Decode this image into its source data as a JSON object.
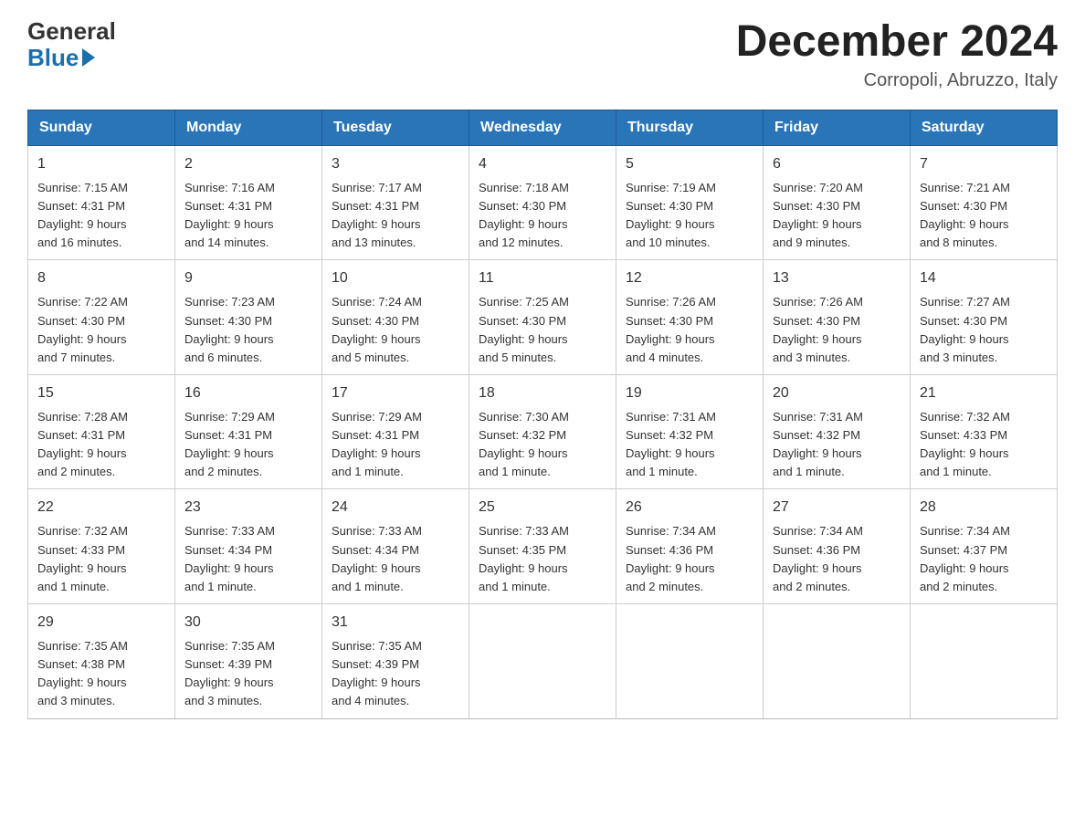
{
  "header": {
    "logo_general": "General",
    "logo_blue": "Blue",
    "month_title": "December 2024",
    "location": "Corropoli, Abruzzo, Italy"
  },
  "days_of_week": [
    "Sunday",
    "Monday",
    "Tuesday",
    "Wednesday",
    "Thursday",
    "Friday",
    "Saturday"
  ],
  "weeks": [
    [
      {
        "day": "1",
        "sunrise": "7:15 AM",
        "sunset": "4:31 PM",
        "daylight": "9 hours and 16 minutes."
      },
      {
        "day": "2",
        "sunrise": "7:16 AM",
        "sunset": "4:31 PM",
        "daylight": "9 hours and 14 minutes."
      },
      {
        "day": "3",
        "sunrise": "7:17 AM",
        "sunset": "4:31 PM",
        "daylight": "9 hours and 13 minutes."
      },
      {
        "day": "4",
        "sunrise": "7:18 AM",
        "sunset": "4:30 PM",
        "daylight": "9 hours and 12 minutes."
      },
      {
        "day": "5",
        "sunrise": "7:19 AM",
        "sunset": "4:30 PM",
        "daylight": "9 hours and 10 minutes."
      },
      {
        "day": "6",
        "sunrise": "7:20 AM",
        "sunset": "4:30 PM",
        "daylight": "9 hours and 9 minutes."
      },
      {
        "day": "7",
        "sunrise": "7:21 AM",
        "sunset": "4:30 PM",
        "daylight": "9 hours and 8 minutes."
      }
    ],
    [
      {
        "day": "8",
        "sunrise": "7:22 AM",
        "sunset": "4:30 PM",
        "daylight": "9 hours and 7 minutes."
      },
      {
        "day": "9",
        "sunrise": "7:23 AM",
        "sunset": "4:30 PM",
        "daylight": "9 hours and 6 minutes."
      },
      {
        "day": "10",
        "sunrise": "7:24 AM",
        "sunset": "4:30 PM",
        "daylight": "9 hours and 5 minutes."
      },
      {
        "day": "11",
        "sunrise": "7:25 AM",
        "sunset": "4:30 PM",
        "daylight": "9 hours and 5 minutes."
      },
      {
        "day": "12",
        "sunrise": "7:26 AM",
        "sunset": "4:30 PM",
        "daylight": "9 hours and 4 minutes."
      },
      {
        "day": "13",
        "sunrise": "7:26 AM",
        "sunset": "4:30 PM",
        "daylight": "9 hours and 3 minutes."
      },
      {
        "day": "14",
        "sunrise": "7:27 AM",
        "sunset": "4:30 PM",
        "daylight": "9 hours and 3 minutes."
      }
    ],
    [
      {
        "day": "15",
        "sunrise": "7:28 AM",
        "sunset": "4:31 PM",
        "daylight": "9 hours and 2 minutes."
      },
      {
        "day": "16",
        "sunrise": "7:29 AM",
        "sunset": "4:31 PM",
        "daylight": "9 hours and 2 minutes."
      },
      {
        "day": "17",
        "sunrise": "7:29 AM",
        "sunset": "4:31 PM",
        "daylight": "9 hours and 1 minute."
      },
      {
        "day": "18",
        "sunrise": "7:30 AM",
        "sunset": "4:32 PM",
        "daylight": "9 hours and 1 minute."
      },
      {
        "day": "19",
        "sunrise": "7:31 AM",
        "sunset": "4:32 PM",
        "daylight": "9 hours and 1 minute."
      },
      {
        "day": "20",
        "sunrise": "7:31 AM",
        "sunset": "4:32 PM",
        "daylight": "9 hours and 1 minute."
      },
      {
        "day": "21",
        "sunrise": "7:32 AM",
        "sunset": "4:33 PM",
        "daylight": "9 hours and 1 minute."
      }
    ],
    [
      {
        "day": "22",
        "sunrise": "7:32 AM",
        "sunset": "4:33 PM",
        "daylight": "9 hours and 1 minute."
      },
      {
        "day": "23",
        "sunrise": "7:33 AM",
        "sunset": "4:34 PM",
        "daylight": "9 hours and 1 minute."
      },
      {
        "day": "24",
        "sunrise": "7:33 AM",
        "sunset": "4:34 PM",
        "daylight": "9 hours and 1 minute."
      },
      {
        "day": "25",
        "sunrise": "7:33 AM",
        "sunset": "4:35 PM",
        "daylight": "9 hours and 1 minute."
      },
      {
        "day": "26",
        "sunrise": "7:34 AM",
        "sunset": "4:36 PM",
        "daylight": "9 hours and 2 minutes."
      },
      {
        "day": "27",
        "sunrise": "7:34 AM",
        "sunset": "4:36 PM",
        "daylight": "9 hours and 2 minutes."
      },
      {
        "day": "28",
        "sunrise": "7:34 AM",
        "sunset": "4:37 PM",
        "daylight": "9 hours and 2 minutes."
      }
    ],
    [
      {
        "day": "29",
        "sunrise": "7:35 AM",
        "sunset": "4:38 PM",
        "daylight": "9 hours and 3 minutes."
      },
      {
        "day": "30",
        "sunrise": "7:35 AM",
        "sunset": "4:39 PM",
        "daylight": "9 hours and 3 minutes."
      },
      {
        "day": "31",
        "sunrise": "7:35 AM",
        "sunset": "4:39 PM",
        "daylight": "9 hours and 4 minutes."
      },
      null,
      null,
      null,
      null
    ]
  ],
  "labels": {
    "sunrise_prefix": "Sunrise: ",
    "sunset_prefix": "Sunset: ",
    "daylight_prefix": "Daylight: "
  }
}
